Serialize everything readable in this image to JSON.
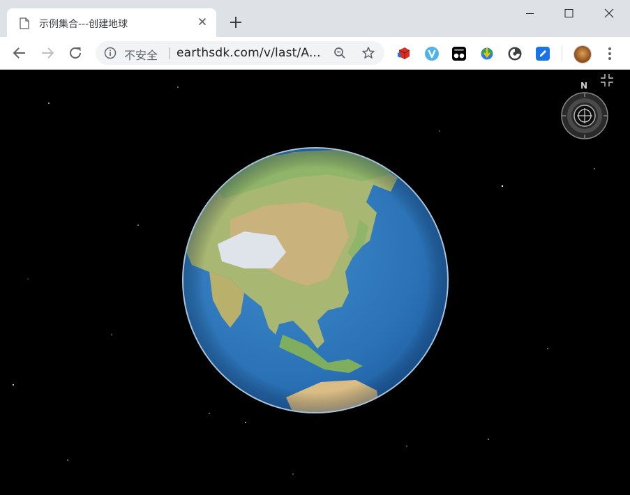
{
  "browser": {
    "tab": {
      "title": "示例集合---创建地球",
      "favicon": "page-icon",
      "close_icon": "close-icon"
    },
    "new_tab_icon": "plus-icon",
    "window_controls": [
      "minimize-icon",
      "maximize-icon",
      "close-icon"
    ],
    "nav": {
      "back_icon": "back-arrow-icon",
      "forward_icon": "forward-arrow-icon",
      "reload_icon": "reload-icon"
    },
    "omnibox": {
      "security_icon": "info-icon",
      "security_text": "不安全",
      "separator": "|",
      "url": "earthsdk.com/v/last/A...",
      "zoom_icon": "zoom-out-icon",
      "bookmark_icon": "star-icon"
    },
    "extensions": [
      "cube-extension-icon",
      "v-extension-icon",
      "tampermonkey-extension-icon",
      "idm-extension-icon",
      "circle-extension-icon",
      "blue-square-extension-icon"
    ],
    "profile_icon": "avatar",
    "menu_icon": "kebab-menu-icon"
  },
  "viewer": {
    "compass": {
      "north_label": "N"
    },
    "fullscreen_icon": "fullscreen-icon",
    "background_color": "#000000"
  }
}
